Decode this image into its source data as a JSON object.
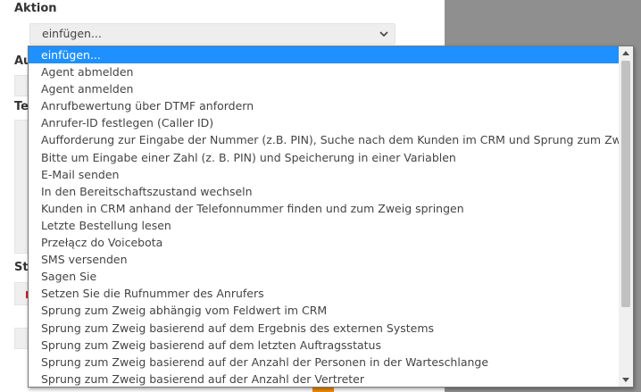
{
  "section": {
    "title": "Aktion"
  },
  "select": {
    "value": "einfügen..."
  },
  "background_labels": {
    "label_1": "Au",
    "label_2": "Te",
    "label_3": "Sti"
  },
  "dropdown": {
    "options": [
      "einfügen...",
      "Agent abmelden",
      "Agent anmelden",
      "Anrufbewertung über DTMF anfordern",
      "Anrufer-ID festlegen (Caller ID)",
      "Aufforderung zur Eingabe der Nummer (z.B. PIN), Suche nach dem Kunden im CRM und Sprung zum Zweig",
      "Bitte um Eingabe einer Zahl (z. B. PIN) und Speicherung in einer Variablen",
      "E-Mail senden",
      "In den Bereitschaftszustand wechseln",
      "Kunden in CRM anhand der Telefonnummer finden und zum Zweig springen",
      "Letzte Bestellung lesen",
      "Przełącz do Voicebota",
      "SMS versenden",
      "Sagen Sie",
      "Setzen Sie die Rufnummer des Anrufers",
      "Sprung zum Zweig abhängig vom Feldwert im CRM",
      "Sprung zum Zweig basierend auf dem Ergebnis des externen Systems",
      "Sprung zum Zweig basierend auf dem letzten Auftragsstatus",
      "Sprung zum Zweig basierend auf der Anzahl der Personen in der Warteschlange",
      "Sprung zum Zweig basierend auf der Anzahl der Vertreter"
    ],
    "selected_index": 0
  },
  "colors": {
    "selected": "#1e90ff",
    "overlay": "#8f8f8f",
    "accent": "#f08c00"
  },
  "icons": {
    "select_arrow": "chevron-down-icon",
    "scroll_up": "triangle-up-icon",
    "scroll_down": "triangle-down-icon"
  }
}
